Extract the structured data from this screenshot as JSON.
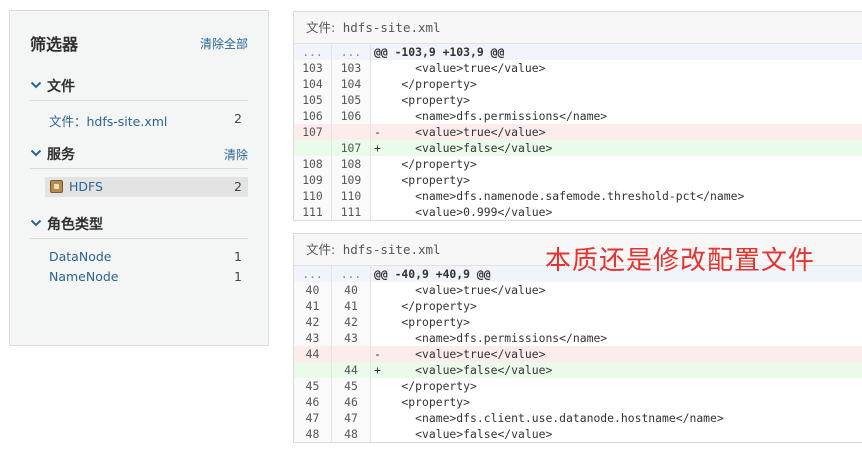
{
  "filter": {
    "title": "筛选器",
    "clear_all": "清除全部",
    "sections": [
      {
        "label": "文件",
        "clear": "",
        "items": [
          {
            "label": "文件：hdfs-site.xml",
            "count": "2"
          }
        ]
      },
      {
        "label": "服务",
        "clear": "清除",
        "items": [
          {
            "label": "HDFS",
            "count": "2",
            "icon": "hdfs-service-icon"
          }
        ]
      },
      {
        "label": "角色类型",
        "clear": "",
        "items": [
          {
            "label": "DataNode",
            "count": "1"
          },
          {
            "label": "NameNode",
            "count": "1"
          }
        ]
      }
    ]
  },
  "diffs": [
    {
      "file_label": "文件:",
      "file_name": "hdfs-site.xml",
      "lines": [
        {
          "type": "hunk",
          "old": "...",
          "new": "...",
          "code": "@@ -103,9 +103,9 @@"
        },
        {
          "type": "ctx",
          "old": "103",
          "new": "103",
          "code": "      <value>true</value>"
        },
        {
          "type": "ctx",
          "old": "104",
          "new": "104",
          "code": "    </property>"
        },
        {
          "type": "ctx",
          "old": "105",
          "new": "105",
          "code": "    <property>"
        },
        {
          "type": "ctx",
          "old": "106",
          "new": "106",
          "code": "      <name>dfs.permissions</name>"
        },
        {
          "type": "del",
          "old": "107",
          "new": "",
          "code": "-     <value>true</value>"
        },
        {
          "type": "add",
          "old": "",
          "new": "107",
          "code": "+     <value>false</value>"
        },
        {
          "type": "ctx",
          "old": "108",
          "new": "108",
          "code": "    </property>"
        },
        {
          "type": "ctx",
          "old": "109",
          "new": "109",
          "code": "    <property>"
        },
        {
          "type": "ctx",
          "old": "110",
          "new": "110",
          "code": "      <name>dfs.namenode.safemode.threshold-pct</name>"
        },
        {
          "type": "ctx",
          "old": "111",
          "new": "111",
          "code": "      <value>0.999</value>"
        }
      ]
    },
    {
      "file_label": "文件:",
      "file_name": "hdfs-site.xml",
      "lines": [
        {
          "type": "hunk",
          "old": "...",
          "new": "...",
          "code": "@@ -40,9 +40,9 @@"
        },
        {
          "type": "ctx",
          "old": "40",
          "new": "40",
          "code": "      <value>true</value>"
        },
        {
          "type": "ctx",
          "old": "41",
          "new": "41",
          "code": "    </property>"
        },
        {
          "type": "ctx",
          "old": "42",
          "new": "42",
          "code": "    <property>"
        },
        {
          "type": "ctx",
          "old": "43",
          "new": "43",
          "code": "      <name>dfs.permissions</name>"
        },
        {
          "type": "del",
          "old": "44",
          "new": "",
          "code": "-     <value>true</value>"
        },
        {
          "type": "add",
          "old": "",
          "new": "44",
          "code": "+     <value>false</value>"
        },
        {
          "type": "ctx",
          "old": "45",
          "new": "45",
          "code": "    </property>"
        },
        {
          "type": "ctx",
          "old": "46",
          "new": "46",
          "code": "    <property>"
        },
        {
          "type": "ctx",
          "old": "47",
          "new": "47",
          "code": "      <name>dfs.client.use.datanode.hostname</name>"
        },
        {
          "type": "ctx",
          "old": "48",
          "new": "48",
          "code": "      <value>false</value>"
        }
      ]
    }
  ],
  "annotation": "本质还是修改配置文件",
  "colors": {
    "link": "#2a6496",
    "annotation": "#e8322e",
    "deleted_bg": "#fdecec",
    "added_bg": "#eafbea"
  }
}
